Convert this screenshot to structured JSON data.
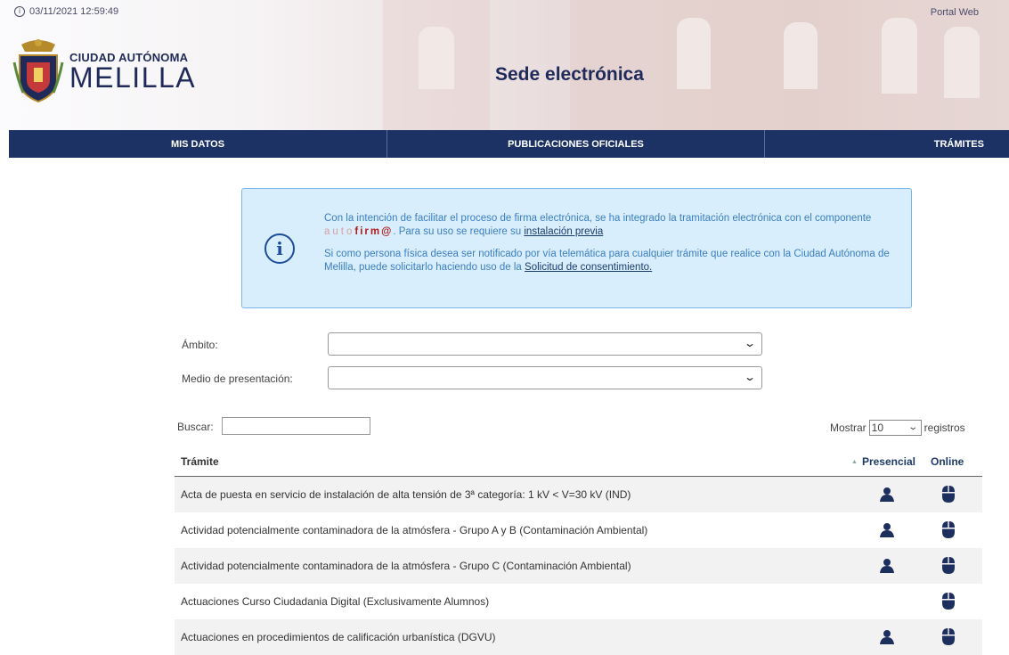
{
  "header": {
    "datetime": "03/11/2021 12:59:49",
    "portal_link": "Portal Web",
    "logo_line1": "CIUDAD AUTÓNOMA",
    "logo_line2": "MELILLA",
    "site_title": "Sede electrónica"
  },
  "nav": {
    "items": [
      "MIS DATOS",
      "PUBLICACIONES OFICIALES",
      "TRÁMITES"
    ]
  },
  "info": {
    "p1_before": "Con la intención de facilitar el proceso de firma electrónica, se ha integrado la tramitación electrónica con el componente ",
    "autofirma_a": "auto",
    "autofirma_b": "firm@",
    "p1_after": ". Para su uso se requiere su ",
    "p1_link": "instalación previa",
    "p2_before": "Si como persona física desea ser notificado por vía telemática para cualquier trámite que realice con la Ciudad Autónoma de Melilla, puede solicitarlo haciendo uso de la ",
    "p2_link": "Solicitud de consentimiento."
  },
  "filters": {
    "ambito_label": "Ámbito:",
    "ambito_value": "",
    "medio_label": "Medio de presentación:",
    "medio_value": ""
  },
  "search": {
    "label": "Buscar:",
    "value": ""
  },
  "pagination": {
    "show_label": "Mostrar",
    "show_value": "10",
    "records_label": "registros"
  },
  "table": {
    "col_tramite": "Trámite",
    "col_presencial": "Presencial",
    "col_online": "Online",
    "rows": [
      {
        "name": "Acta de puesta en servicio de instalación de alta tensión de 3ª categoría: 1 kV < V=30 kV (IND)",
        "presencial": true,
        "online": true
      },
      {
        "name": "Actividad potencialmente contaminadora de la atmósfera - Grupo A y B (Contaminación Ambiental)",
        "presencial": true,
        "online": true
      },
      {
        "name": "Actividad potencialmente contaminadora de la atmósfera - Grupo C (Contaminación Ambiental)",
        "presencial": true,
        "online": true
      },
      {
        "name": "Actuaciones Curso Ciudadania Digital (Exclusivamente Alumnos)",
        "presencial": false,
        "online": true
      },
      {
        "name": "Actuaciones en procedimientos de calificación urbanística (DGVU)",
        "presencial": true,
        "online": true
      }
    ]
  },
  "icons": {
    "presencial": "person-icon",
    "online": "mouse-icon",
    "info": "info-icon",
    "clock": "clock-icon"
  },
  "colors": {
    "nav_bg": "#1d3264",
    "info_bg": "#d9eefc",
    "info_border": "#7cb6e8",
    "info_text": "#3a7fc2",
    "brand": "#1f2a5a"
  }
}
